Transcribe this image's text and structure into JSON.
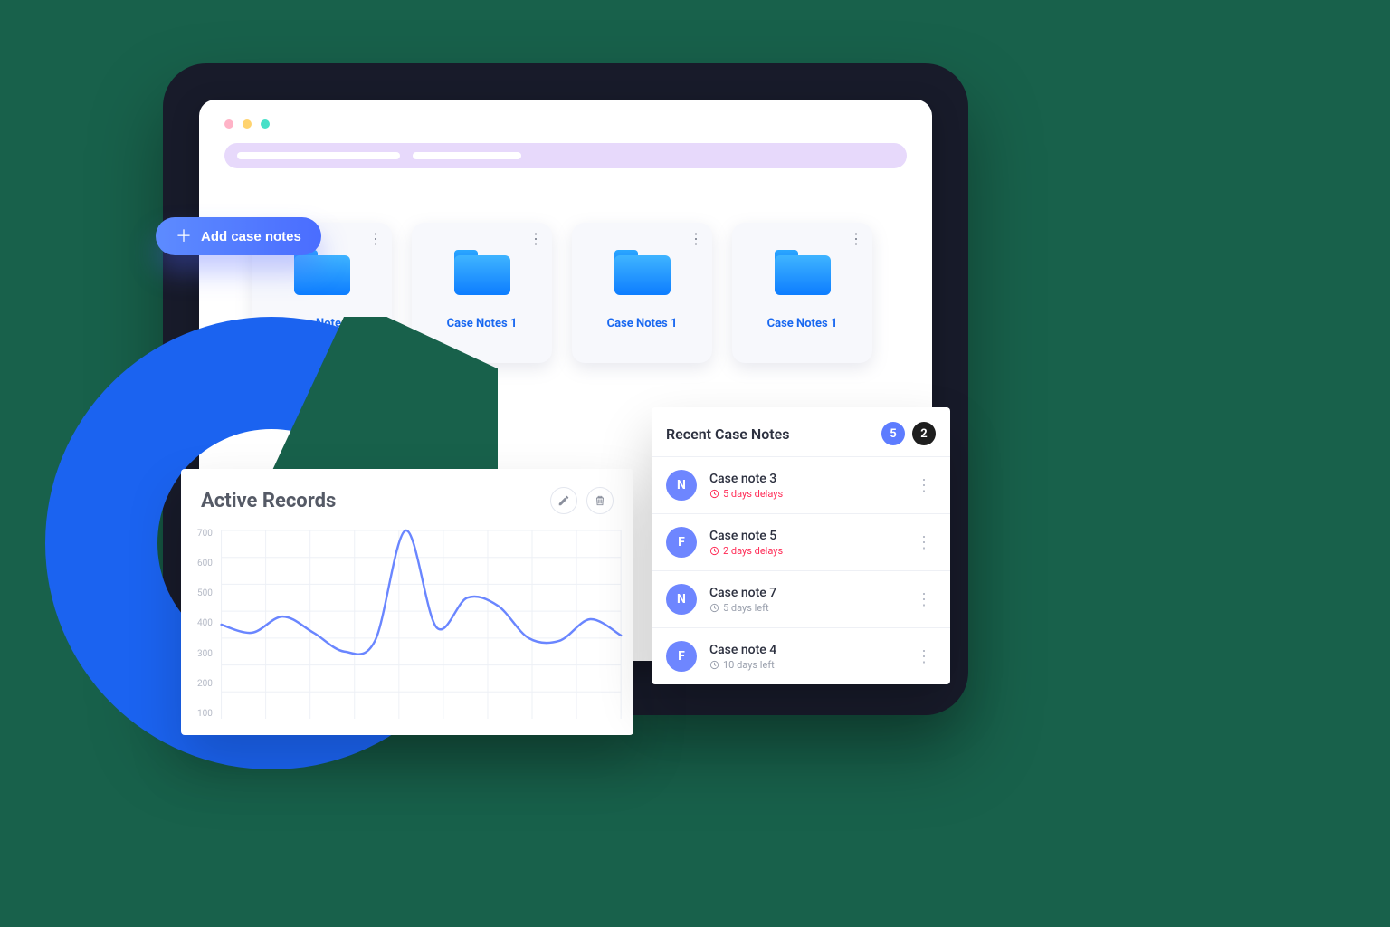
{
  "actions": {
    "add_label": "Add case notes"
  },
  "folders": [
    {
      "label": "Case Notes 1"
    },
    {
      "label": "Case Notes 1"
    },
    {
      "label": "Case Notes 1"
    },
    {
      "label": "Case Notes 1"
    }
  ],
  "records": {
    "title": "Active Records"
  },
  "chart_data": {
    "type": "line",
    "title": "Active Records",
    "ylabel": "",
    "xlabel": "",
    "ylim": [
      0,
      700
    ],
    "y_ticks": [
      700,
      600,
      500,
      400,
      300,
      200,
      100
    ],
    "x": [
      0,
      1,
      2,
      3,
      4,
      5,
      6,
      7,
      8,
      9,
      10,
      11,
      12,
      13
    ],
    "values": [
      350,
      320,
      380,
      320,
      250,
      290,
      700,
      340,
      450,
      420,
      300,
      290,
      370,
      310
    ]
  },
  "recent": {
    "title": "Recent Case Notes",
    "badge_primary": "5",
    "badge_secondary": "2",
    "items": [
      {
        "avatar": "N",
        "title": "Case note 3",
        "status_text": "5 days delays",
        "status_type": "delay"
      },
      {
        "avatar": "F",
        "title": "Case note 5",
        "status_text": "2 days delays",
        "status_type": "delay"
      },
      {
        "avatar": "N",
        "title": "Case note 7",
        "status_text": "5 days left",
        "status_type": "ok"
      },
      {
        "avatar": "F",
        "title": "Case note 4",
        "status_text": "10 days left",
        "status_type": "ok"
      }
    ]
  }
}
